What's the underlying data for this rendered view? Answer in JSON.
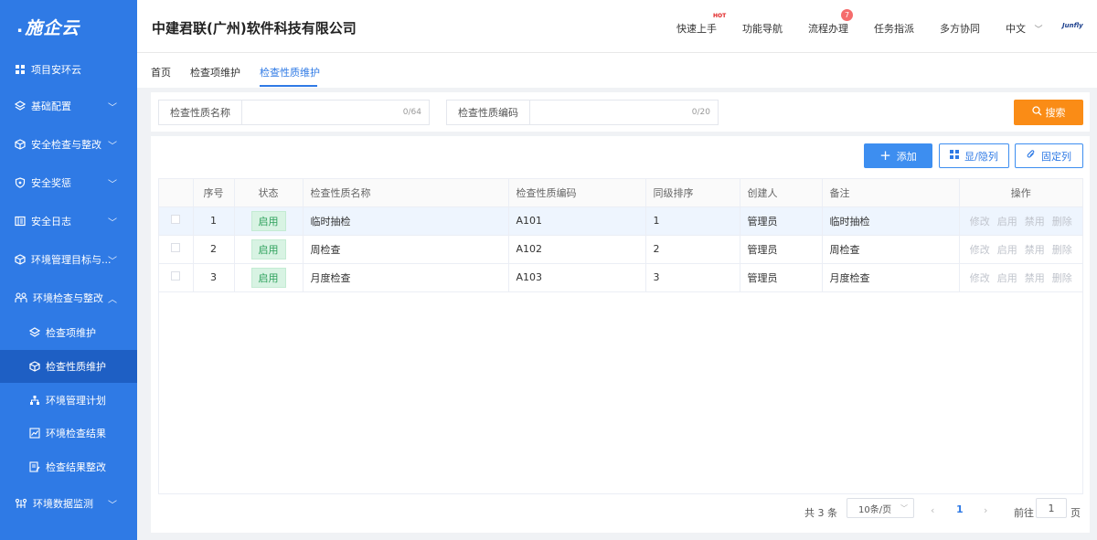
{
  "sidebar": {
    "logo": "施企云",
    "items": [
      {
        "label": "项目安环云",
        "icon": "grid-icon"
      },
      {
        "label": "基础配置",
        "icon": "layers-icon"
      },
      {
        "label": "安全检查与整改",
        "icon": "cube-icon"
      },
      {
        "label": "安全奖惩",
        "icon": "shield-icon"
      },
      {
        "label": "安全日志",
        "icon": "log-icon"
      },
      {
        "label": "环境管理目标与...",
        "icon": "cube-icon"
      },
      {
        "label": "环境检查与整改",
        "icon": "people-icon"
      },
      {
        "label": "检查项维护",
        "icon": "layers-icon"
      },
      {
        "label": "检查性质维护",
        "icon": "cube-icon"
      },
      {
        "label": "环境管理计划",
        "icon": "org-icon"
      },
      {
        "label": "环境检查结果",
        "icon": "chart-icon"
      },
      {
        "label": "检查结果整改",
        "icon": "edit-icon"
      },
      {
        "label": "环境数据监测",
        "icon": "monitor-icon"
      }
    ]
  },
  "header": {
    "company": "中建君联(广州)软件科技有限公司",
    "nav": {
      "quick_start": "快速上手",
      "hot": "HOT",
      "func_nav": "功能导航",
      "process": "流程办理",
      "process_badge": "7",
      "task": "任务指派",
      "collab": "多方协同",
      "lang": "中文",
      "brand": "Junfly"
    }
  },
  "tabs": [
    "首页",
    "检查项维护",
    "检查性质维护"
  ],
  "search": {
    "name_label": "检查性质名称",
    "name_count": "0/64",
    "code_label": "检查性质编码",
    "code_count": "0/20",
    "button": "搜索"
  },
  "toolbar": {
    "add": "添加",
    "toggle_columns": "显/隐列",
    "fix_columns": "固定列"
  },
  "table": {
    "headers": [
      "序号",
      "状态",
      "检查性质名称",
      "检查性质编码",
      "同级排序",
      "创建人",
      "备注",
      "操作"
    ],
    "rows": [
      {
        "index": "1",
        "status": "启用",
        "name": "临时抽检",
        "code": "A101",
        "sort": "1",
        "creator": "管理员",
        "remark": "临时抽检"
      },
      {
        "index": "2",
        "status": "启用",
        "name": "周检查",
        "code": "A102",
        "sort": "2",
        "creator": "管理员",
        "remark": "周检查"
      },
      {
        "index": "3",
        "status": "启用",
        "name": "月度检查",
        "code": "A103",
        "sort": "3",
        "creator": "管理员",
        "remark": "月度检查"
      }
    ],
    "actions": [
      "修改",
      "启用",
      "禁用",
      "删除"
    ]
  },
  "pagination": {
    "total": "共 3 条",
    "page_size": "10条/页",
    "current": "1",
    "goto_label": "前往",
    "goto_value": "1",
    "page_suffix": "页"
  }
}
